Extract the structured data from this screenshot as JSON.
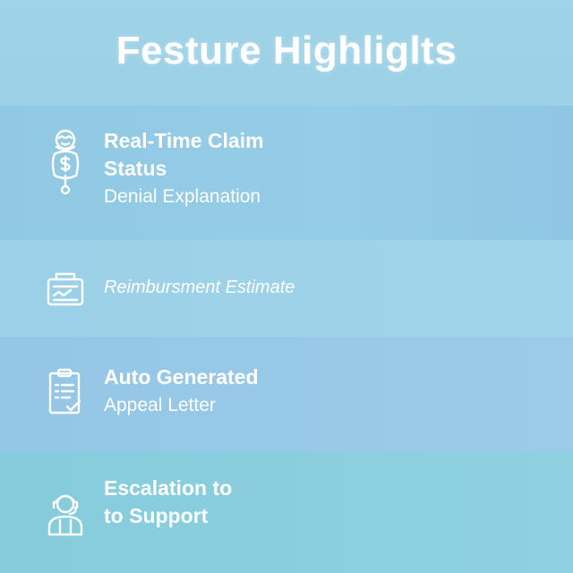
{
  "header": {
    "title": "Festure Highliglts"
  },
  "features": [
    {
      "icon": "agent-icon",
      "title_1": "Real-Time Claim",
      "title_2": "Status",
      "subtitle": "Denial Explanation"
    },
    {
      "icon": "estimate-icon",
      "subtitle": "Reimbursment Estimate"
    },
    {
      "icon": "clipboard-icon",
      "title_1": "Auto Generated",
      "subtitle": "Appeal Letter"
    },
    {
      "icon": "support-icon",
      "title_1": "Escalation to",
      "title_2": "to Support"
    }
  ]
}
